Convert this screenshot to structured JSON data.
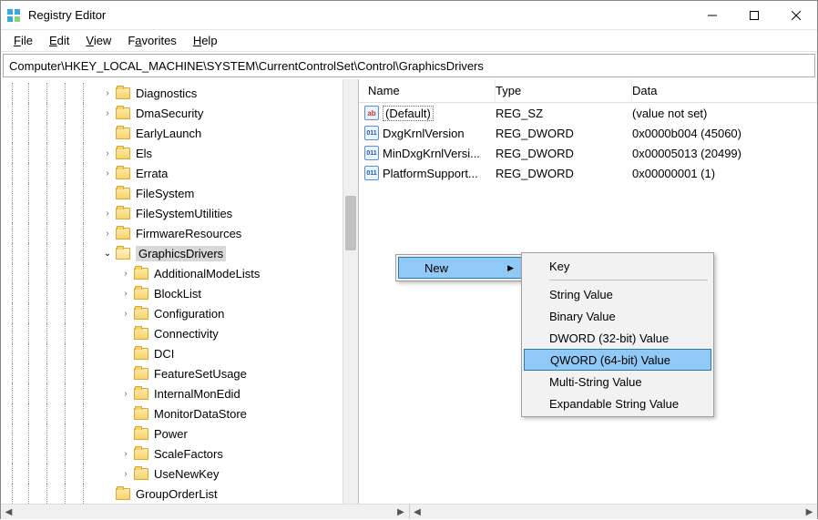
{
  "window": {
    "title": "Registry Editor"
  },
  "menus": {
    "file": "File",
    "edit": "Edit",
    "view": "View",
    "favorites": "Favorites",
    "help": "Help"
  },
  "address": "Computer\\HKEY_LOCAL_MACHINE\\SYSTEM\\CurrentControlSet\\Control\\GraphicsDrivers",
  "tree": {
    "items": [
      {
        "label": "Diagnostics",
        "indent": 110,
        "exp": ">"
      },
      {
        "label": "DmaSecurity",
        "indent": 110,
        "exp": ">"
      },
      {
        "label": "EarlyLaunch",
        "indent": 110,
        "exp": ""
      },
      {
        "label": "Els",
        "indent": 110,
        "exp": ">"
      },
      {
        "label": "Errata",
        "indent": 110,
        "exp": ">"
      },
      {
        "label": "FileSystem",
        "indent": 110,
        "exp": ""
      },
      {
        "label": "FileSystemUtilities",
        "indent": 110,
        "exp": ">"
      },
      {
        "label": "FirmwareResources",
        "indent": 110,
        "exp": ">"
      },
      {
        "label": "GraphicsDrivers",
        "indent": 110,
        "exp": "v",
        "open": true,
        "selected": true
      },
      {
        "label": "AdditionalModeLists",
        "indent": 130,
        "exp": ">"
      },
      {
        "label": "BlockList",
        "indent": 130,
        "exp": ">"
      },
      {
        "label": "Configuration",
        "indent": 130,
        "exp": ">"
      },
      {
        "label": "Connectivity",
        "indent": 130,
        "exp": ""
      },
      {
        "label": "DCI",
        "indent": 130,
        "exp": ""
      },
      {
        "label": "FeatureSetUsage",
        "indent": 130,
        "exp": ""
      },
      {
        "label": "InternalMonEdid",
        "indent": 130,
        "exp": ">"
      },
      {
        "label": "MonitorDataStore",
        "indent": 130,
        "exp": ""
      },
      {
        "label": "Power",
        "indent": 130,
        "exp": ""
      },
      {
        "label": "ScaleFactors",
        "indent": 130,
        "exp": ">"
      },
      {
        "label": "UseNewKey",
        "indent": 130,
        "exp": ">"
      },
      {
        "label": "GroupOrderList",
        "indent": 110,
        "exp": ""
      }
    ]
  },
  "list": {
    "headers": {
      "name": "Name",
      "type": "Type",
      "data": "Data"
    },
    "rows": [
      {
        "icon": "str",
        "name": "(Default)",
        "type": "REG_SZ",
        "data": "(value not set)",
        "boxed": true
      },
      {
        "icon": "bin",
        "name": "DxgKrnlVersion",
        "type": "REG_DWORD",
        "data": "0x0000b004 (45060)"
      },
      {
        "icon": "bin",
        "name": "MinDxgKrnlVersi...",
        "type": "REG_DWORD",
        "data": "0x00005013 (20499)"
      },
      {
        "icon": "bin",
        "name": "PlatformSupport...",
        "type": "REG_DWORD",
        "data": "0x00000001 (1)"
      }
    ]
  },
  "contextmenu": {
    "new": "New",
    "sub": {
      "key": "Key",
      "string": "String Value",
      "binary": "Binary Value",
      "dword": "DWORD (32-bit) Value",
      "qword": "QWORD (64-bit) Value",
      "multi": "Multi-String Value",
      "expand": "Expandable String Value"
    }
  }
}
